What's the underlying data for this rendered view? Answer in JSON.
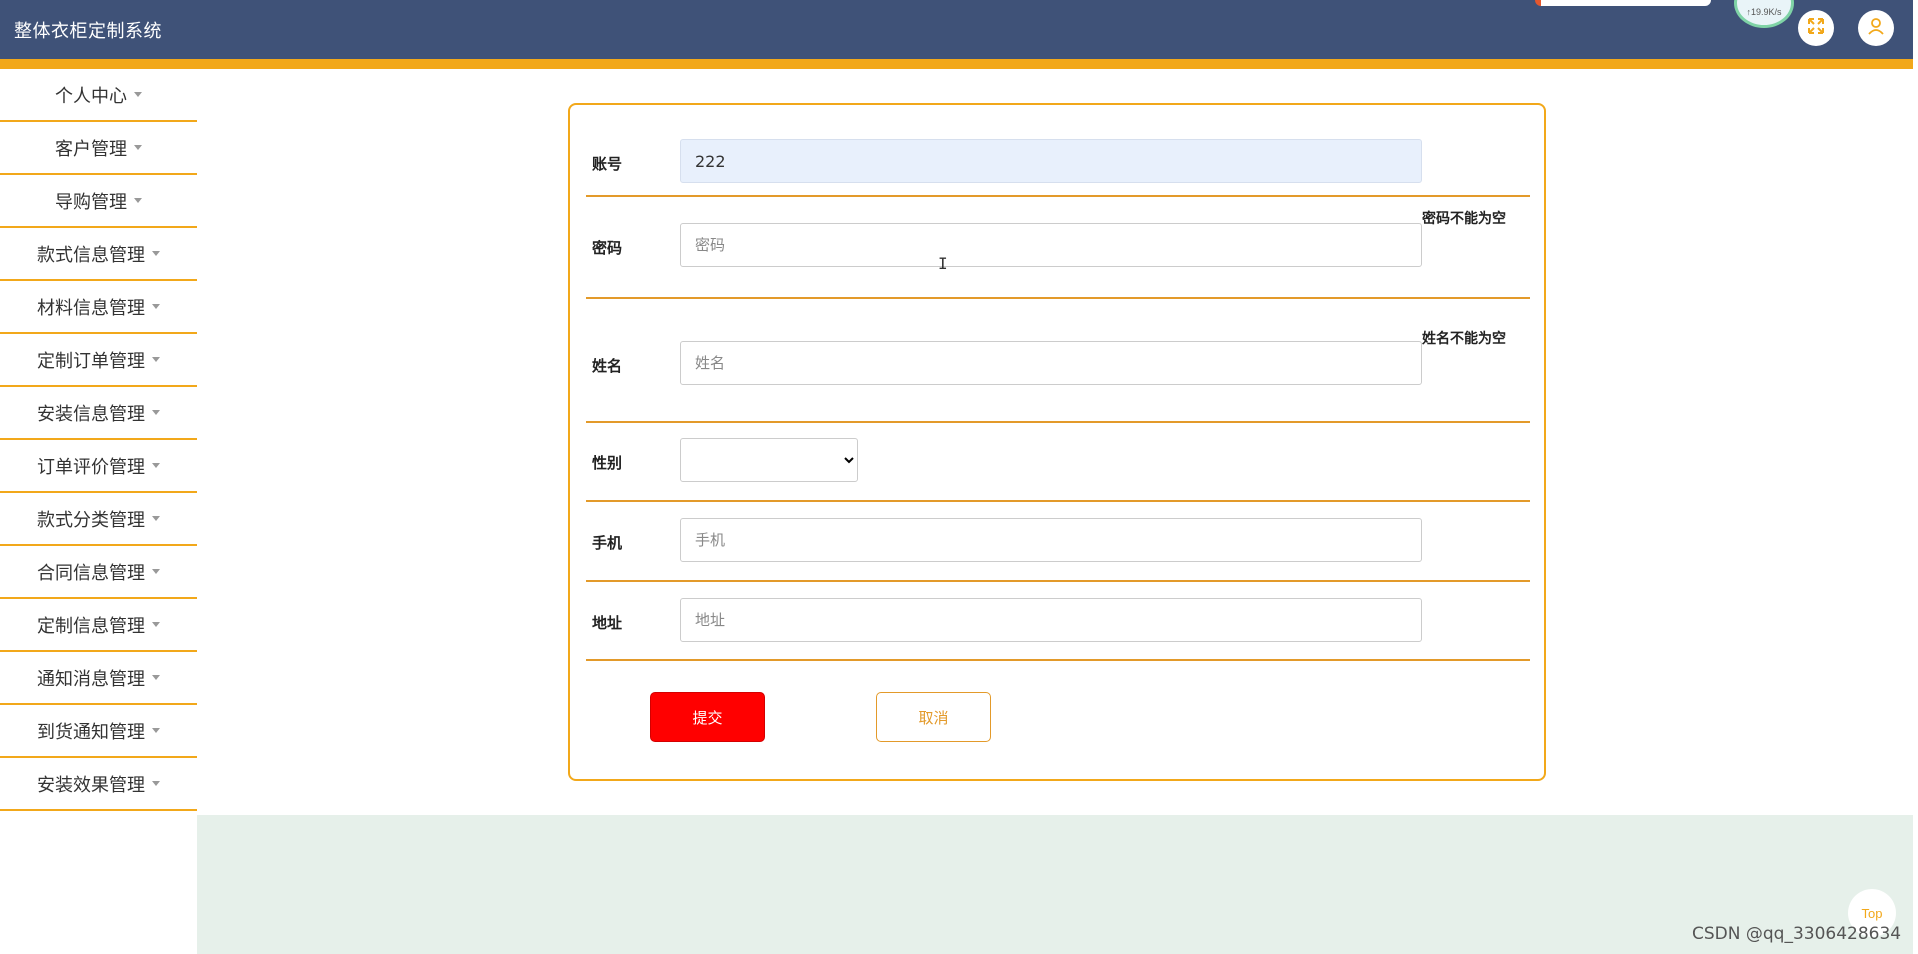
{
  "app": {
    "title": "整体衣柜定制系统"
  },
  "header": {
    "net_speed": "↑19.9K/s",
    "icons": [
      "fullscreen-icon",
      "user-icon"
    ]
  },
  "sidebar": {
    "items": [
      {
        "label": "个人中心"
      },
      {
        "label": "客户管理"
      },
      {
        "label": "导购管理"
      },
      {
        "label": "款式信息管理"
      },
      {
        "label": "材料信息管理"
      },
      {
        "label": "定制订单管理"
      },
      {
        "label": "安装信息管理"
      },
      {
        "label": "订单评价管理"
      },
      {
        "label": "款式分类管理"
      },
      {
        "label": "合同信息管理"
      },
      {
        "label": "定制信息管理"
      },
      {
        "label": "通知消息管理"
      },
      {
        "label": "到货通知管理"
      },
      {
        "label": "安装效果管理"
      }
    ]
  },
  "form": {
    "account": {
      "label": "账号",
      "value": "222"
    },
    "password": {
      "label": "密码",
      "placeholder": "密码",
      "value": "",
      "error": "密码不能为空"
    },
    "name": {
      "label": "姓名",
      "placeholder": "姓名",
      "value": "",
      "error": "姓名不能为空"
    },
    "gender": {
      "label": "性别",
      "selected": ""
    },
    "phone": {
      "label": "手机",
      "placeholder": "手机",
      "value": ""
    },
    "address": {
      "label": "地址",
      "placeholder": "地址",
      "value": ""
    },
    "submit_label": "提交",
    "cancel_label": "取消"
  },
  "scroll_top_label": "Top",
  "watermark": "CSDN @qq_3306428634",
  "colors": {
    "header_bg": "#3f5278",
    "accent": "#f2a81a",
    "submit_bg": "#ff0000",
    "content_bg": "#e6f0ea",
    "filled_input_bg": "#e8f0fc"
  }
}
